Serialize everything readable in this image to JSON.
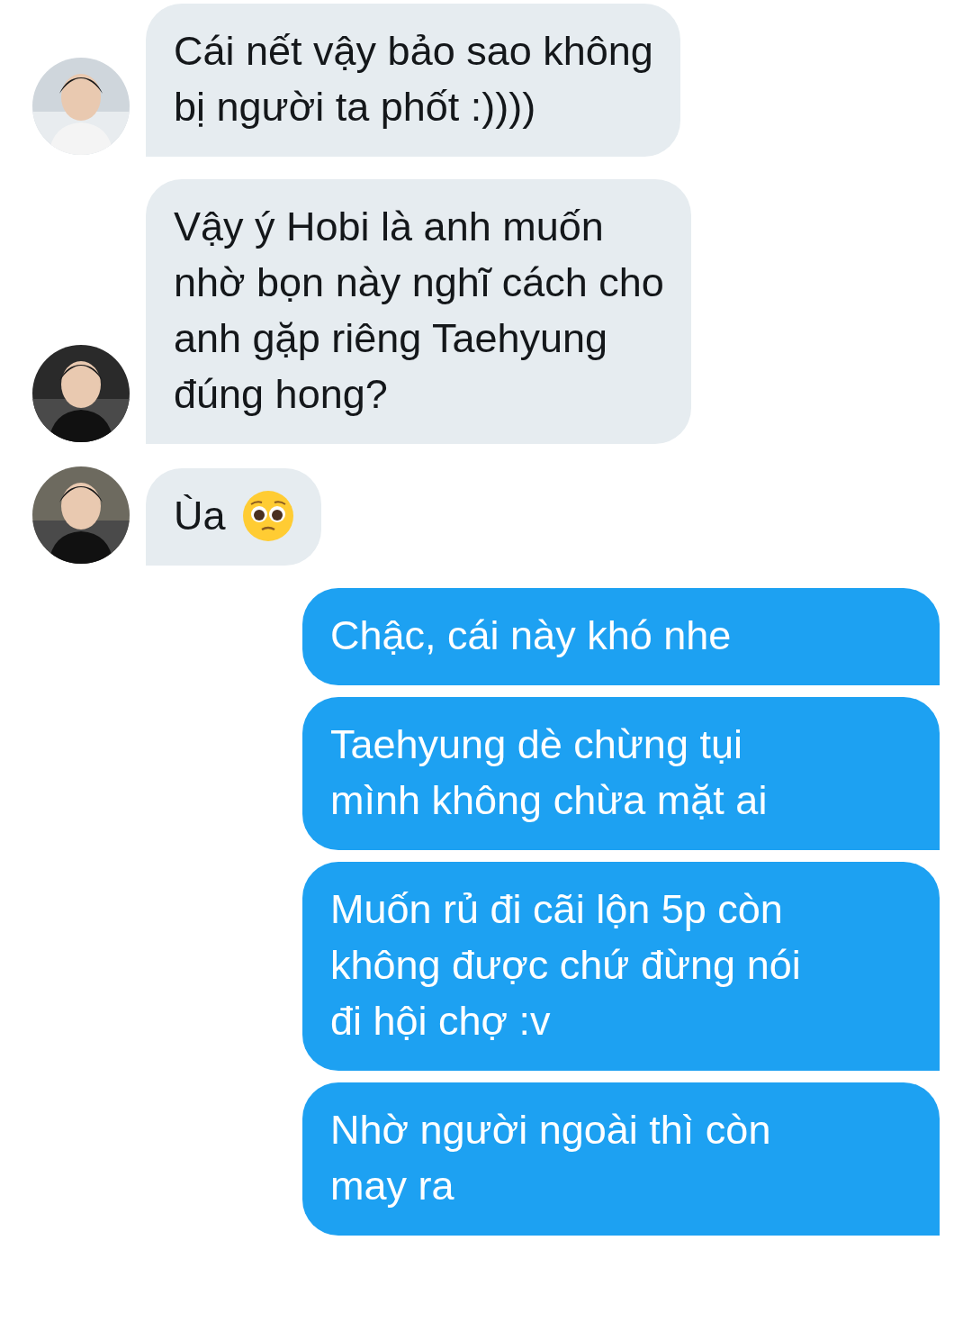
{
  "messages": [
    {
      "kind": "received",
      "text": "Cái nết vậy bảo sao không\nbị người ta phốt :))))"
    },
    {
      "kind": "received",
      "text": "Vậy ý Hobi là anh muốn\nnhờ bọn này nghĩ cách cho\nanh gặp riêng Taehyung\nđúng hong?"
    },
    {
      "kind": "received",
      "text": "Ùa",
      "emoji": {
        "kind": "pleading"
      }
    },
    {
      "kind": "sent",
      "text": "Chậc, cái này khó nhe"
    },
    {
      "kind": "sent",
      "text": "Taehyung dè chừng tụi\nmình không chừa mặt ai"
    },
    {
      "kind": "sent",
      "text": "Muốn rủ đi cãi lộn 5p còn\nkhông được chứ đừng nói\nđi hội chợ :v"
    },
    {
      "kind": "sent",
      "text": "Nhờ người ngoài thì còn\nmay ra"
    }
  ]
}
